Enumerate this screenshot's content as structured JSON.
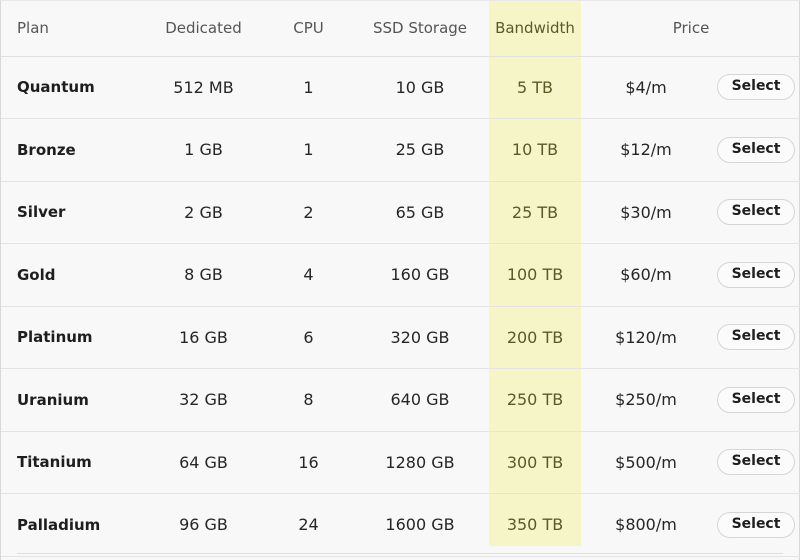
{
  "table": {
    "name": "hosting-plan-pricing-table",
    "highlight_column": "Bandwidth",
    "colors": {
      "page_background": "#f8f8f8",
      "highlight_background": "#f5f5c8",
      "highlight_text": "#5a5a28",
      "header_text": "#555555",
      "body_text": "#262626",
      "plan_text": "#1e1e1e",
      "row_divider": "#e4e4e4",
      "button_border": "#d5d5d5"
    },
    "headers": {
      "plan": "Plan",
      "dedicated": "Dedicated",
      "cpu": "CPU",
      "ssd_storage": "SSD Storage",
      "bandwidth": "Bandwidth",
      "price": "Price"
    },
    "action_label": "Select",
    "rows": [
      {
        "plan": "Quantum",
        "dedicated": "512 MB",
        "cpu": "1",
        "ssd": "10 GB",
        "bandwidth": "5 TB",
        "price": "$4/m",
        "action": "Select"
      },
      {
        "plan": "Bronze",
        "dedicated": "1 GB",
        "cpu": "1",
        "ssd": "25 GB",
        "bandwidth": "10 TB",
        "price": "$12/m",
        "action": "Select"
      },
      {
        "plan": "Silver",
        "dedicated": "2 GB",
        "cpu": "2",
        "ssd": "65 GB",
        "bandwidth": "25 TB",
        "price": "$30/m",
        "action": "Select"
      },
      {
        "plan": "Gold",
        "dedicated": "8 GB",
        "cpu": "4",
        "ssd": "160 GB",
        "bandwidth": "100 TB",
        "price": "$60/m",
        "action": "Select"
      },
      {
        "plan": "Platinum",
        "dedicated": "16 GB",
        "cpu": "6",
        "ssd": "320 GB",
        "bandwidth": "200 TB",
        "price": "$120/m",
        "action": "Select"
      },
      {
        "plan": "Uranium",
        "dedicated": "32 GB",
        "cpu": "8",
        "ssd": "640 GB",
        "bandwidth": "250 TB",
        "price": "$250/m",
        "action": "Select"
      },
      {
        "plan": "Titanium",
        "dedicated": "64 GB",
        "cpu": "16",
        "ssd": "1280 GB",
        "bandwidth": "300 TB",
        "price": "$500/m",
        "action": "Select"
      },
      {
        "plan": "Palladium",
        "dedicated": "96 GB",
        "cpu": "24",
        "ssd": "1600 GB",
        "bandwidth": "350 TB",
        "price": "$800/m",
        "action": "Select"
      }
    ]
  }
}
